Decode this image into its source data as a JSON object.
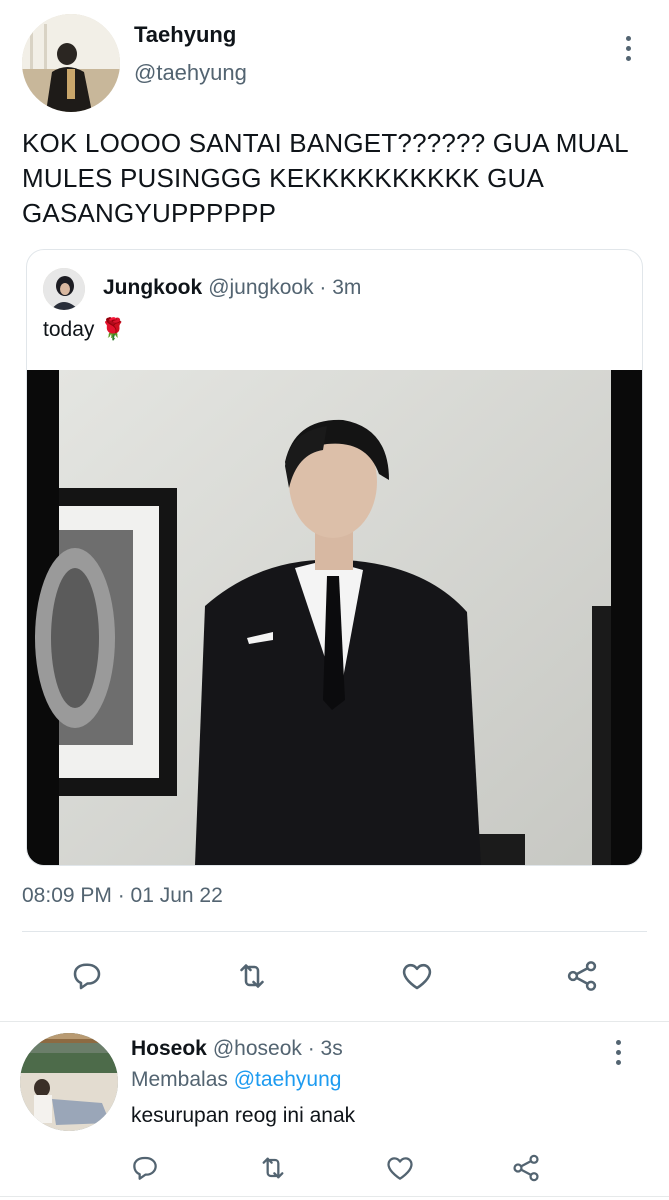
{
  "tweet": {
    "display_name": "Taehyung",
    "handle": "@taehyung",
    "text": "KOK LOOOO SANTAI BANGET?????? GUA MUAL MULES PUSINGGG KEKKKKKKKKKK GUA GASANGYUPPPPPP",
    "timestamp": "08:09 PM · 01 Jun 22",
    "more_icon": "more-vertical-icon"
  },
  "quoted_tweet": {
    "display_name": "Jungkook",
    "handle_time": "@jungkook · 3m",
    "text": "today 🌹"
  },
  "actions": [
    {
      "icon": "reply-icon"
    },
    {
      "icon": "retweet-icon"
    },
    {
      "icon": "like-icon"
    },
    {
      "icon": "share-icon"
    }
  ],
  "reply": {
    "display_name": "Hoseok",
    "handle_time": "@hoseok · 3s",
    "replying_prefix": "Membalas",
    "replying_to": "@taehyung",
    "text": "kesurupan reog ini anak"
  },
  "colors": {
    "accent": "#1d9bf0",
    "secondary_text": "#536471",
    "border": "#e1e6ea"
  }
}
